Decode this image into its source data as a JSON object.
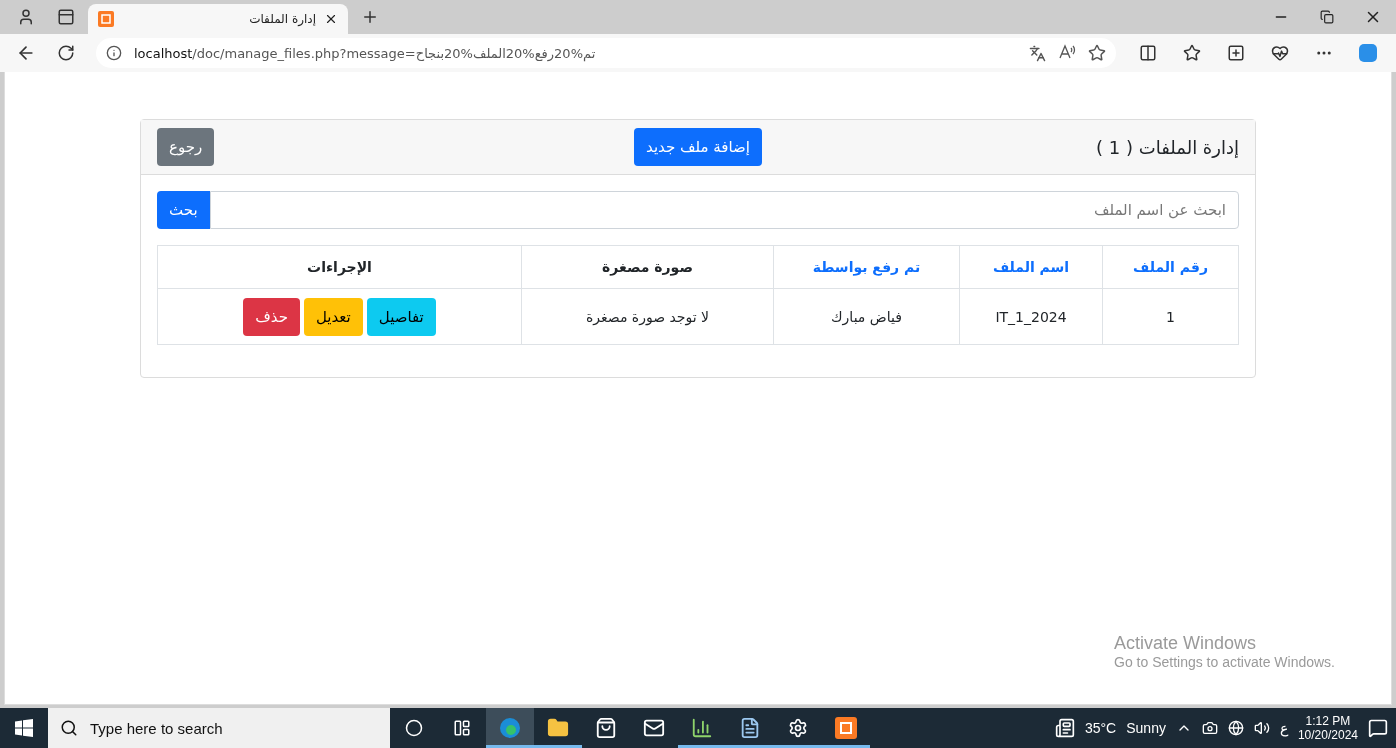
{
  "browser": {
    "tabs": [
      {
        "title": "إدارة الملفات",
        "selected": true
      }
    ],
    "address": {
      "host": "localhost",
      "path": "/doc/manage_files.php?message=تم%20رفع%20الملف%20بنجاح"
    }
  },
  "card": {
    "title": "إدارة الملفات ( 1 )",
    "add_button": "إضافة ملف جديد",
    "back_button": "رجوع"
  },
  "search": {
    "placeholder": "ابحث عن اسم الملف",
    "button": "بحث"
  },
  "table": {
    "columns": [
      {
        "label": "رقم الملف",
        "kind": "sortable"
      },
      {
        "label": "اسم الملف",
        "kind": "sortable"
      },
      {
        "label": "تم رفع بواسطة",
        "kind": "sortable"
      },
      {
        "label": "صورة مصغرة",
        "kind": "plain"
      },
      {
        "label": "الإجراءات",
        "kind": "plain"
      }
    ],
    "rows": [
      {
        "cells": [
          "1",
          "IT_1_2024",
          "فياض مبارك",
          "لا توجد صورة مصغرة"
        ],
        "actions": [
          {
            "label": "تفاصيل",
            "kind": "info"
          },
          {
            "label": "تعديل",
            "kind": "warning"
          },
          {
            "label": "حذف",
            "kind": "danger"
          }
        ]
      }
    ]
  },
  "activation": {
    "title": "Activate Windows",
    "subtitle": "Go to Settings to activate Windows."
  },
  "taskbar": {
    "search_placeholder": "Type here to search",
    "apps": [
      {
        "kind": "cortana",
        "selected": false,
        "running": false
      },
      {
        "kind": "taskview",
        "selected": false,
        "running": false
      },
      {
        "kind": "edge",
        "selected": true,
        "running": true
      },
      {
        "kind": "explorer",
        "selected": false,
        "running": true
      },
      {
        "kind": "store",
        "selected": false,
        "running": false
      },
      {
        "kind": "mail",
        "selected": false,
        "running": false
      },
      {
        "kind": "chart",
        "selected": false,
        "running": true
      },
      {
        "kind": "notepad",
        "selected": false,
        "running": true
      },
      {
        "kind": "settings",
        "selected": false,
        "running": true
      },
      {
        "kind": "xampp",
        "selected": false,
        "running": true
      }
    ],
    "weather": "35°C",
    "weather_text": "Sunny",
    "language": "ع",
    "time": "1:12 PM",
    "date": "10/20/2024"
  }
}
